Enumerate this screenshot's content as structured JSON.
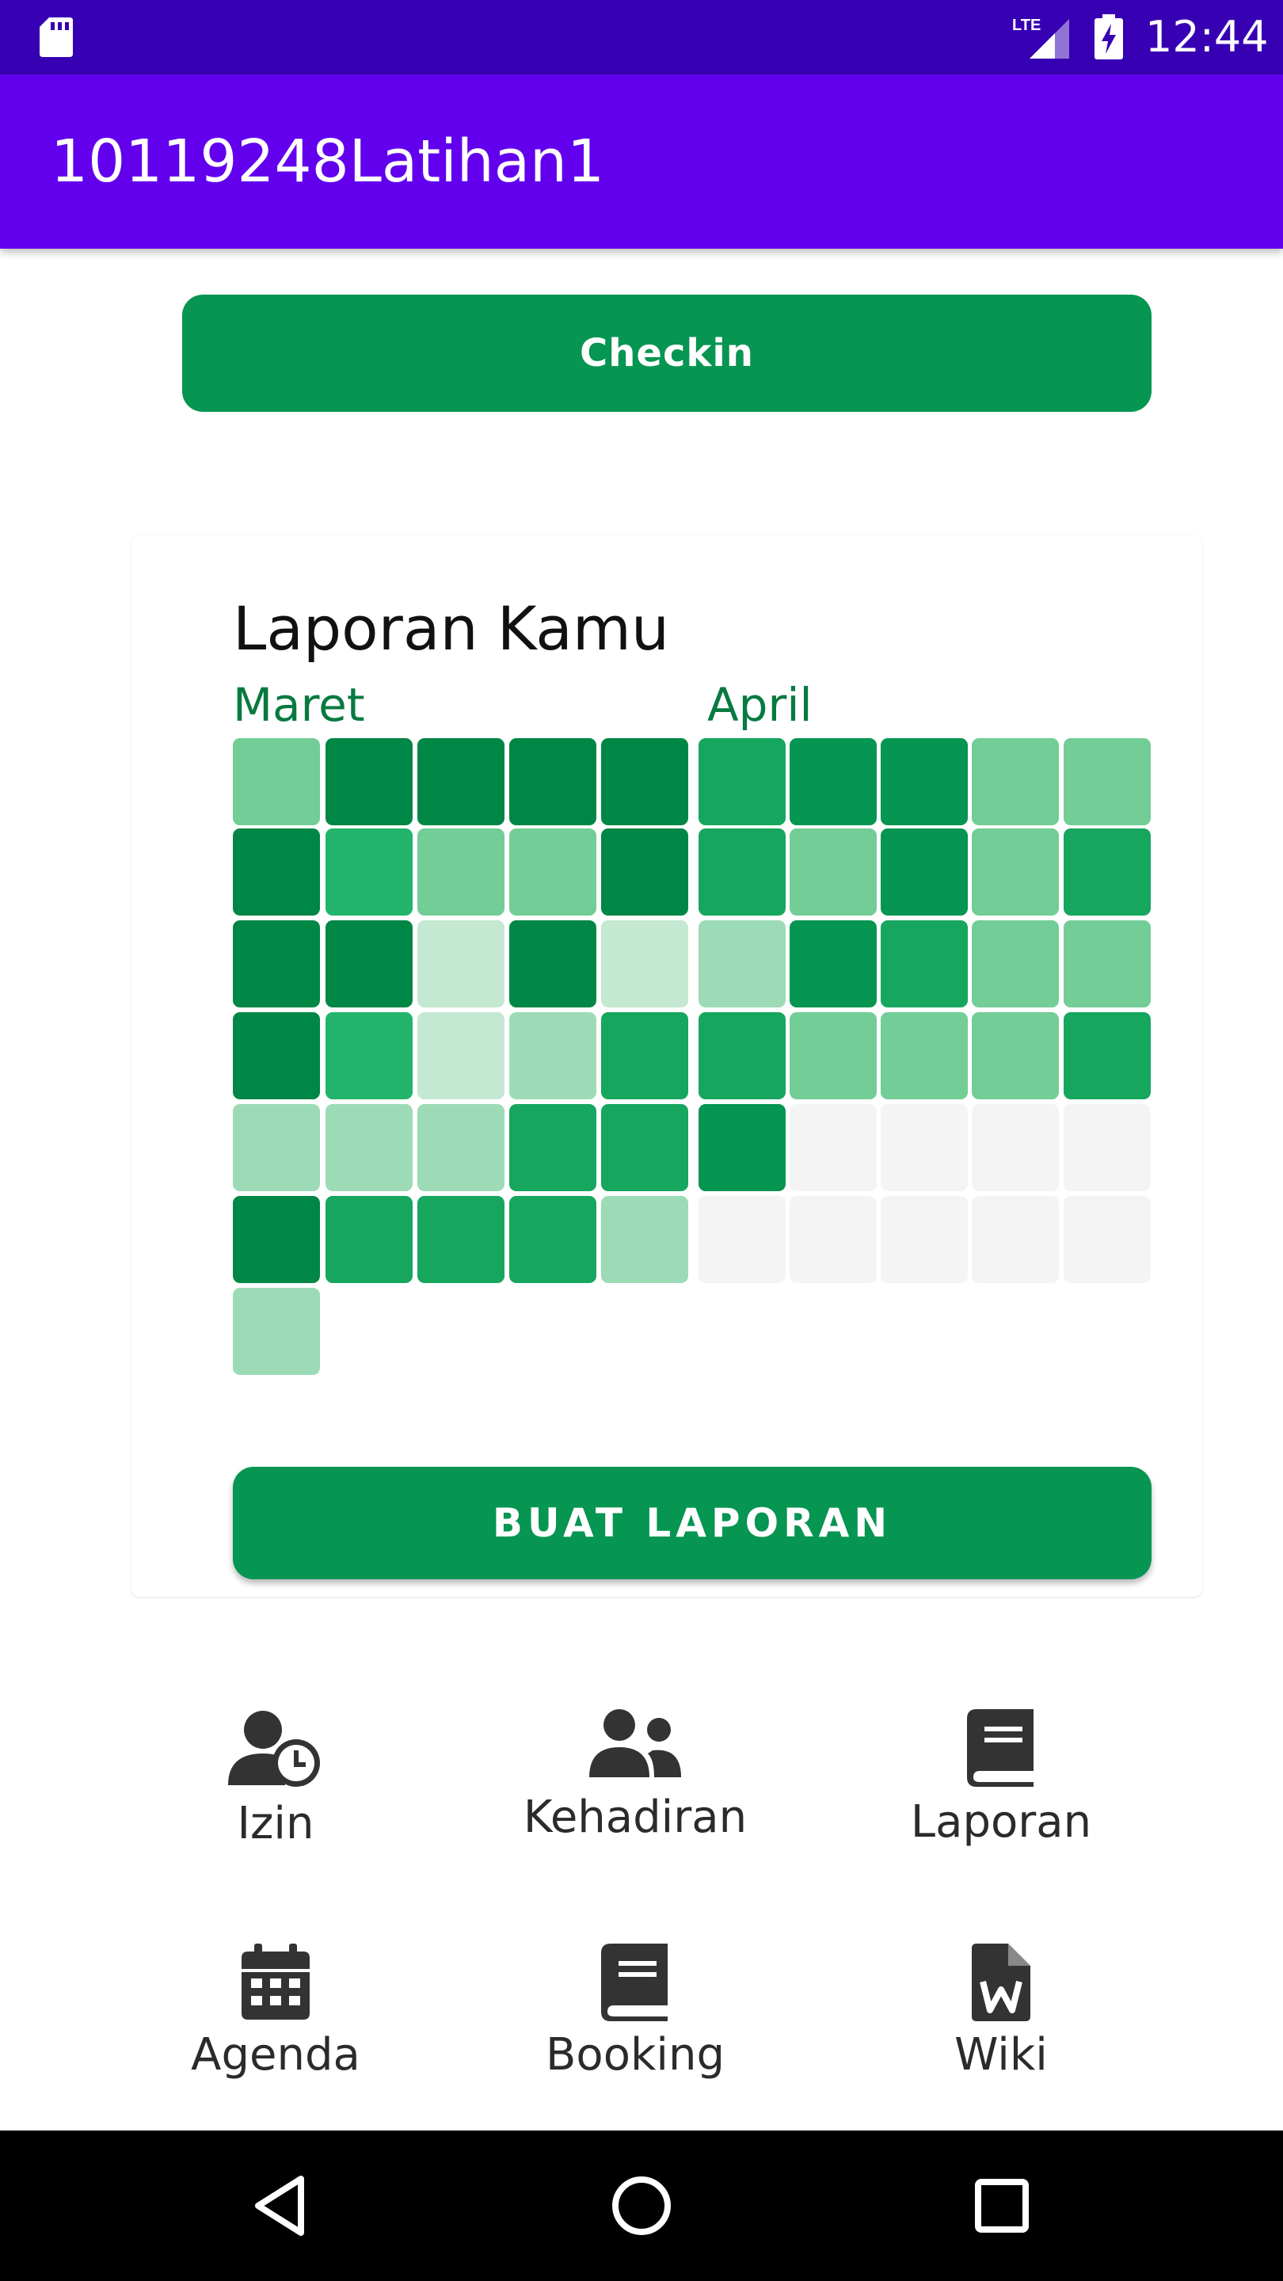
{
  "status_bar": {
    "time": "12:44",
    "network": "LTE",
    "icons": [
      "sd-card-icon",
      "lte-signal-icon",
      "battery-charging-icon"
    ]
  },
  "app_bar": {
    "title": "10119248Latihan1"
  },
  "checkin_button": {
    "label": "Checkin"
  },
  "report": {
    "title": "Laporan Kamu",
    "months": [
      "Maret",
      "April"
    ],
    "colors": {
      "0": "#f4f4f4",
      "1": "#c4e8d2",
      "2": "#9cdbb6",
      "3": "#72cd96",
      "4": "#22b46a",
      "5": "#17a65e",
      "6": "#079552",
      "7": "#008645"
    },
    "heatmap_rows": [
      [
        3,
        7,
        7,
        7,
        7,
        5,
        6,
        6,
        3,
        3
      ],
      [
        7,
        4,
        3,
        3,
        7,
        5,
        3,
        6,
        3,
        5
      ],
      [
        7,
        7,
        1,
        7,
        1,
        2,
        6,
        5,
        3,
        3
      ],
      [
        7,
        4,
        1,
        2,
        5,
        5,
        3,
        3,
        3,
        5
      ],
      [
        2,
        2,
        2,
        5,
        5,
        6,
        0,
        0,
        0,
        0
      ],
      [
        7,
        5,
        5,
        5,
        2,
        0,
        0,
        0,
        0,
        0
      ],
      [
        2
      ]
    ],
    "button_label": "BUAT LAPORAN"
  },
  "menu": [
    {
      "label": "Izin",
      "icon": "user-clock-icon"
    },
    {
      "label": "Kehadiran",
      "icon": "users-icon"
    },
    {
      "label": "Laporan",
      "icon": "book-icon"
    },
    {
      "label": "Agenda",
      "icon": "calendar-icon"
    },
    {
      "label": "Booking",
      "icon": "book-icon"
    },
    {
      "label": "Wiki",
      "icon": "wiki-document-icon"
    }
  ],
  "nav_bar": {
    "icons": [
      "back-icon",
      "home-icon",
      "recents-icon"
    ]
  }
}
